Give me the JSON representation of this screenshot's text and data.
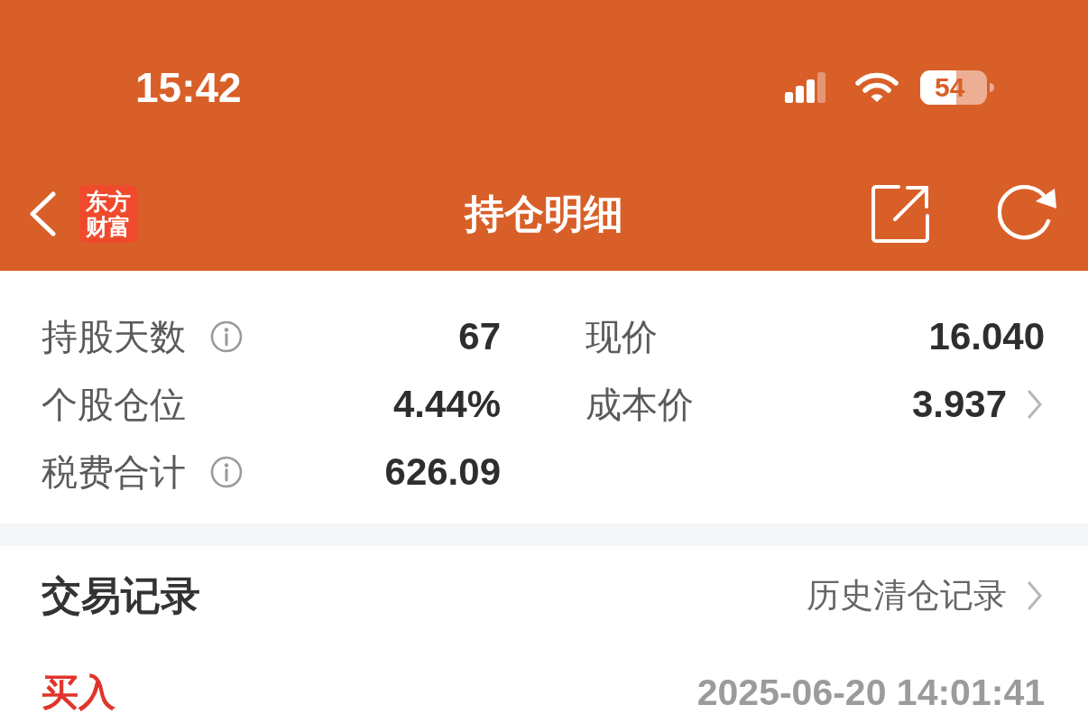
{
  "status_bar": {
    "time": "15:42",
    "battery": "54"
  },
  "header": {
    "logo": [
      "东方",
      "财富"
    ],
    "title": "持仓明细"
  },
  "summary": {
    "rows": [
      {
        "cells": [
          {
            "label": "持股天数",
            "info": true,
            "value": "67",
            "link": false
          },
          {
            "label": "现价",
            "info": false,
            "value": "16.040",
            "link": false
          }
        ]
      },
      {
        "cells": [
          {
            "label": "个股仓位",
            "info": false,
            "value": "4.44%",
            "link": false
          },
          {
            "label": "成本价",
            "info": false,
            "value": "3.937",
            "link": true
          }
        ]
      },
      {
        "cells": [
          {
            "label": "税费合计",
            "info": true,
            "value": "626.09",
            "link": false
          }
        ]
      }
    ]
  },
  "trade_records": {
    "title": "交易记录",
    "history_link": "历史清仓记录",
    "entries": [
      {
        "kind": "buy",
        "side": "买入",
        "time": "2025-06-20 14:01:41"
      }
    ]
  }
}
